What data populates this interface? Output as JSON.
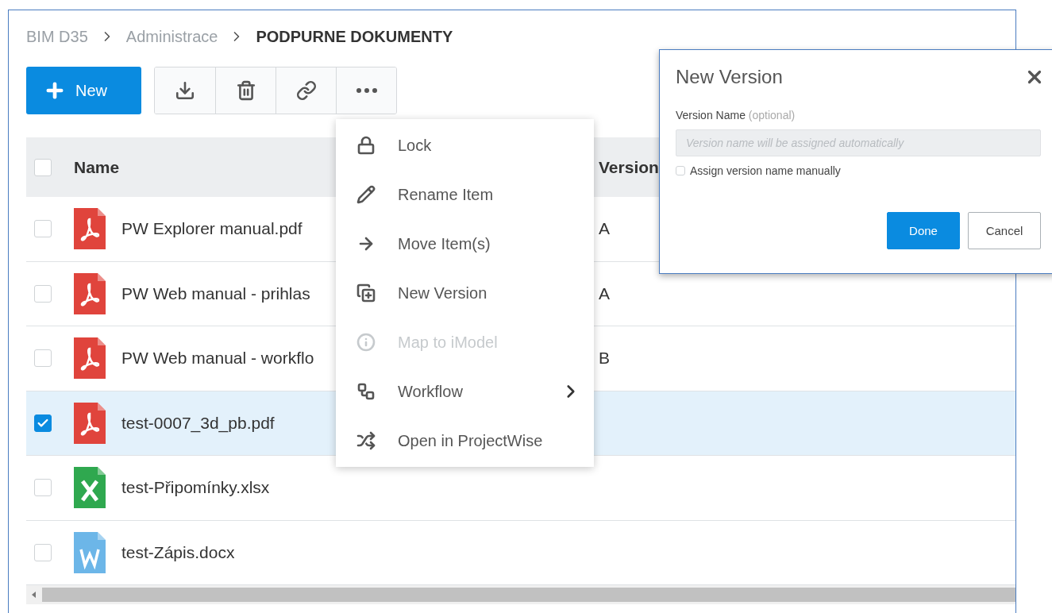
{
  "breadcrumb": [
    {
      "label": "BIM D35",
      "current": false
    },
    {
      "label": "Administrace",
      "current": false
    },
    {
      "label": "PODPURNE DOKUMENTY",
      "current": true
    }
  ],
  "toolbar": {
    "new_button": "New",
    "tools": [
      {
        "kind": "download"
      },
      {
        "kind": "delete"
      },
      {
        "kind": "link"
      },
      {
        "kind": "more"
      }
    ]
  },
  "table": {
    "columns": [
      "Name",
      "Version"
    ],
    "select_all_checked": false,
    "rows": [
      {
        "name": "PW Explorer manual.pdf",
        "kind": "pdf",
        "version": "A",
        "checked": false,
        "selected": false
      },
      {
        "name": "PW Web manual - prihlas",
        "kind": "pdf",
        "version": "A",
        "checked": false,
        "selected": false
      },
      {
        "name": "PW Web manual - workflo",
        "kind": "pdf",
        "version": "B",
        "checked": false,
        "selected": false
      },
      {
        "name": "test-0007_3d_pb.pdf",
        "kind": "pdf",
        "checked": true,
        "selected": true
      },
      {
        "name": "test-Připomínky.xlsx",
        "kind": "xlsx",
        "checked": false,
        "selected": false
      },
      {
        "name": "test-Zápis.docx",
        "kind": "docx",
        "checked": false,
        "selected": false
      }
    ]
  },
  "menu": {
    "items": [
      {
        "kind": "lock",
        "label": "Lock",
        "disabled": false,
        "submenu": false
      },
      {
        "kind": "rename",
        "label": "Rename Item",
        "disabled": false,
        "submenu": false
      },
      {
        "kind": "move",
        "label": "Move Item(s)",
        "disabled": false,
        "submenu": false
      },
      {
        "kind": "version",
        "label": "New Version",
        "disabled": false,
        "submenu": false
      },
      {
        "kind": "map",
        "label": "Map to iModel",
        "disabled": true,
        "submenu": false
      },
      {
        "kind": "workflow",
        "label": "Workflow",
        "disabled": false,
        "submenu": true
      },
      {
        "kind": "open",
        "label": "Open in ProjectWise",
        "disabled": false,
        "submenu": false
      }
    ]
  },
  "dialog": {
    "title": "New Version",
    "field_label": "Version Name",
    "field_hint": "(optional)",
    "placeholder": "Version name will be assigned automatically",
    "checkbox": {
      "label": "Assign version name manually",
      "checked": false
    },
    "buttons": [
      {
        "label": "Done",
        "kind": "primary"
      },
      {
        "label": "Cancel",
        "kind": "secondary"
      }
    ]
  }
}
